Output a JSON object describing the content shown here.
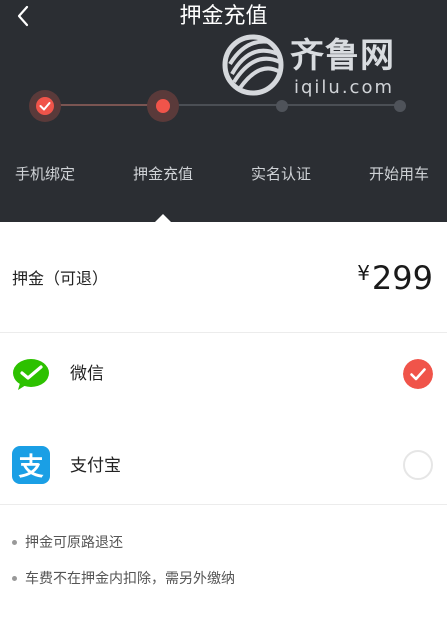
{
  "header": {
    "title": "押金充值",
    "back_icon": "back-arrow-icon",
    "background": "#2b2e33"
  },
  "watermark": {
    "name": "齐鲁网",
    "url": "iqilu.com"
  },
  "steps": [
    {
      "label": "手机绑定",
      "state": "done"
    },
    {
      "label": "押金充值",
      "state": "current"
    },
    {
      "label": "实名认证",
      "state": "pending"
    },
    {
      "label": "开始用车",
      "state": "pending"
    }
  ],
  "deposit": {
    "label": "押金（可退）",
    "currency": "¥",
    "amount": "299"
  },
  "payment_methods": [
    {
      "name": "微信",
      "icon": "wechat-icon",
      "selected": true
    },
    {
      "name": "支付宝",
      "icon": "alipay-icon",
      "selected": false
    }
  ],
  "notes": [
    "押金可原路退还",
    "车费不在押金内扣除，需另外缴纳"
  ],
  "colors": {
    "accent": "#f0544a",
    "wechat": "#2dc100",
    "alipay": "#1a9fe5"
  }
}
